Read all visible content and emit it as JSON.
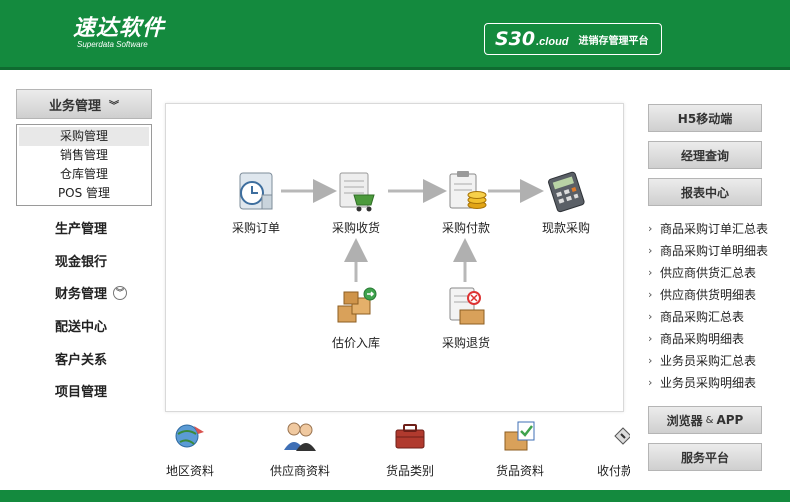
{
  "header": {
    "logo_cn": "速达软件",
    "logo_en": "Superdata Software",
    "product_main": "S30",
    "product_sub": ".cloud",
    "product_tag": "进销存管理平台"
  },
  "left_nav": {
    "business_label": "业务管理",
    "business_chevron": "»",
    "sub_items": [
      "采购管理",
      "销售管理",
      "仓库管理",
      "POS 管理"
    ],
    "items": [
      "生产管理",
      "现金银行",
      "财务管理",
      "配送中心",
      "客户关系",
      "项目管理"
    ]
  },
  "flow": {
    "nodes": [
      {
        "label": "采购订单",
        "icon": "clock-document-icon"
      },
      {
        "label": "采购收货",
        "icon": "shopping-cart-icon"
      },
      {
        "label": "采购付款",
        "icon": "clipboard-coins-icon"
      },
      {
        "label": "现款采购",
        "icon": "calculator-icon"
      },
      {
        "label": "估价入库",
        "icon": "boxes-arrow-icon"
      },
      {
        "label": "采购退货",
        "icon": "return-document-icon"
      }
    ]
  },
  "bottom": {
    "items": [
      {
        "label": "地区资料",
        "icon": "globe-arrow-icon"
      },
      {
        "label": "供应商资料",
        "icon": "people-icon"
      },
      {
        "label": "货品类别",
        "icon": "toolbox-icon"
      },
      {
        "label": "货品资料",
        "icon": "box-check-icon"
      },
      {
        "label": "收付款",
        "icon": "card-icon"
      }
    ]
  },
  "right_nav": {
    "h5_label": "H5移动端",
    "manager_label": "经理查询",
    "report_center_label": "报表中心",
    "reports": [
      "商品采购订单汇总表",
      "商品采购订单明细表",
      "供应商供货汇总表",
      "供应商供货明细表",
      "商品采购汇总表",
      "商品采购明细表",
      "业务员采购汇总表",
      "业务员采购明细表"
    ],
    "browser_label_a": "浏览器",
    "browser_amp": "&",
    "browser_label_b": "APP",
    "service_label": "服务平台"
  },
  "colors": {
    "brand_green": "#148a3e",
    "button_gray": "#d9d9d9"
  }
}
